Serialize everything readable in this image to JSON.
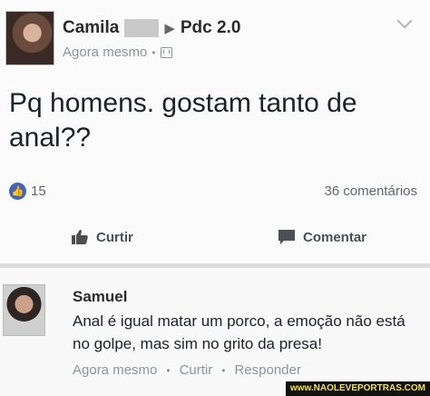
{
  "post": {
    "author_name": "Camila",
    "group_name": "Pdc 2.0",
    "timestamp": "Agora mesmo",
    "text": "Pq homens. gostam tanto de anal??",
    "like_count": "15",
    "comment_count": "36 comentários",
    "actions": {
      "like_label": "Curtir",
      "comment_label": "Comentar"
    }
  },
  "comment": {
    "author_name": "Samuel",
    "text": "Anal é igual matar um porco, a emoção não está no golpe, mas sim no grito da presa!",
    "timestamp": "Agora mesmo",
    "like_label": "Curtir",
    "reply_label": "Responder"
  },
  "watermark": "www.NAOLEVEPORTRAS.COM",
  "colors": {
    "facebook_blue": "#4267b2",
    "meta_gray": "#8d949e",
    "watermark_yellow": "#f0e04a"
  }
}
